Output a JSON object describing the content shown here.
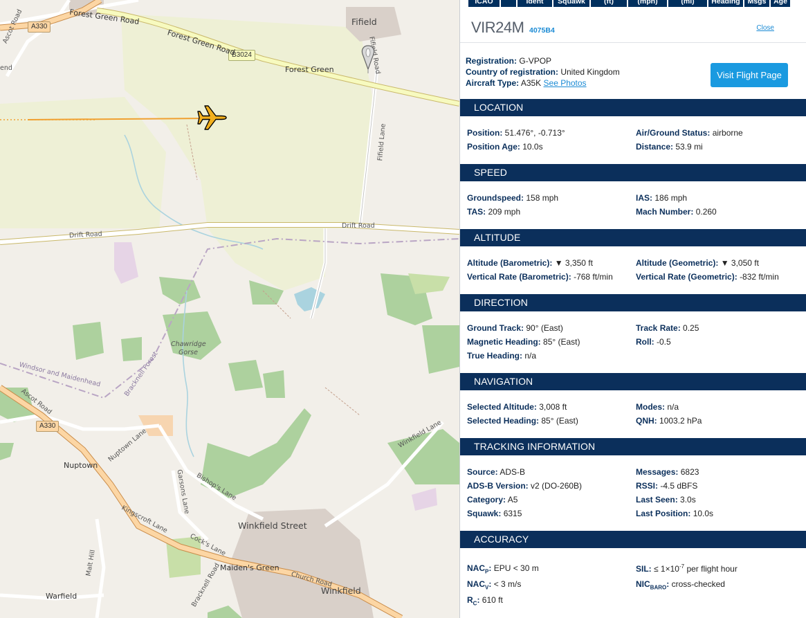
{
  "map": {
    "labels": {
      "fifield": "Fifield",
      "forest_green_road_1": "Forest Green Road",
      "forest_green_road_2": "Forest Green Road",
      "forest_green": "Forest Green",
      "fifield_road": "Fifield Road",
      "fifield_lane": "Fifield Lane",
      "drift_road_w": "Drift Road",
      "drift_road_e": "Drift Road",
      "chawridge_gorse": "Chawridge Gorse",
      "bracknell_forest": "Bracknell Forest",
      "windsor_maidenhead": "Windsor and Maidenhead",
      "ascot_road_n": "Ascot Road",
      "ascot_road_s": "Ascot Road",
      "end": "end",
      "nuptown": "Nuptown",
      "nuptown_lane": "Nuptown Lane",
      "garsons_lane": "Garsons Lane",
      "bishops_lane": "Bishop's Lane",
      "winkfield_street": "Winkfield Street",
      "winkfield_lane": "Winkfield Lane",
      "kingscroft_lane": "Kingscroft Lane",
      "cocks_lane": "Cock's Lane",
      "maidens_green": "Maiden's Green",
      "church_road": "Church Road",
      "winkfield": "Winkfield",
      "bracknell_road": "Bracknell Road",
      "malt_hill": "Malt Hill",
      "warfield": "Warfield",
      "a330_n": "A330",
      "a330_s": "A330",
      "b3024": "B3024"
    },
    "aircraft_icon": "airplane-icon",
    "pin_icon": "map-pin-icon",
    "track_color": "#f0a030"
  },
  "panel": {
    "column_headers": [
      "ICAO",
      "",
      "Ident",
      "Squawk",
      "(ft)",
      "(mph)",
      "(mi)",
      "Heading",
      "Msgs",
      "Age"
    ],
    "callsign": "VIR24M",
    "icao": "4075B4",
    "close_label": "Close",
    "registration_label": "Registration:",
    "registration": "G-VPOP",
    "country_label": "Country of registration:",
    "country": "United Kingdom",
    "aircraft_type_label": "Aircraft Type:",
    "aircraft_type": "A35K",
    "see_photos": "See Photos",
    "visit_button": "Visit Flight Page",
    "sections": {
      "location": {
        "title": "LOCATION",
        "position_label": "Position:",
        "position": "51.476°, -0.713°",
        "air_ground_label": "Air/Ground Status:",
        "air_ground": "airborne",
        "position_age_label": "Position Age:",
        "position_age": "10.0s",
        "distance_label": "Distance:",
        "distance": "53.9 mi"
      },
      "speed": {
        "title": "SPEED",
        "groundspeed_label": "Groundspeed:",
        "groundspeed": "158 mph",
        "ias_label": "IAS:",
        "ias": "186 mph",
        "tas_label": "TAS:",
        "tas": "209 mph",
        "mach_label": "Mach Number:",
        "mach": "0.260"
      },
      "altitude": {
        "title": "ALTITUDE",
        "baro_label": "Altitude (Barometric):",
        "baro": "▼ 3,350 ft",
        "geom_label": "Altitude (Geometric):",
        "geom": "▼ 3,050 ft",
        "vr_baro_label": "Vertical Rate (Barometric):",
        "vr_baro": "-768 ft/min",
        "vr_geom_label": "Vertical Rate (Geometric):",
        "vr_geom": "-832 ft/min"
      },
      "direction": {
        "title": "DIRECTION",
        "ground_track_label": "Ground Track:",
        "ground_track": "90° (East)",
        "track_rate_label": "Track Rate:",
        "track_rate": "0.25",
        "mag_heading_label": "Magnetic Heading:",
        "mag_heading": "85° (East)",
        "roll_label": "Roll:",
        "roll": "-0.5",
        "true_heading_label": "True Heading:",
        "true_heading": "n/a"
      },
      "navigation": {
        "title": "NAVIGATION",
        "sel_alt_label": "Selected Altitude:",
        "sel_alt": "3,008 ft",
        "modes_label": "Modes:",
        "modes": "n/a",
        "sel_heading_label": "Selected Heading:",
        "sel_heading": "85° (East)",
        "qnh_label": "QNH:",
        "qnh": "1003.2 hPa"
      },
      "tracking": {
        "title": "TRACKING INFORMATION",
        "source_label": "Source:",
        "source": "ADS-B",
        "messages_label": "Messages:",
        "messages": "6823",
        "adsb_version_label": "ADS-B Version:",
        "adsb_version": "v2 (DO-260B)",
        "rssi_label": "RSSI:",
        "rssi": "-4.5 dBFS",
        "category_label": "Category:",
        "category": "A5",
        "last_seen_label": "Last Seen:",
        "last_seen": "3.0s",
        "squawk_label": "Squawk:",
        "squawk": "6315",
        "last_position_label": "Last Position:",
        "last_position": "10.0s"
      },
      "accuracy": {
        "title": "ACCURACY",
        "nacp_label": "NAC",
        "nacp_sub": "P",
        "nacp": "EPU < 30 m",
        "sil_label": "SIL:",
        "sil_pre": "≤ 1×10",
        "sil_exp": "-7",
        "sil_post": "per flight hour",
        "nacv_label": "NAC",
        "nacv_sub": "V",
        "nacv": "< 3 m/s",
        "nic_label": "NIC",
        "nic_sub": "BARO",
        "nic": "cross-checked",
        "rc_label": "R",
        "rc_sub": "C",
        "rc": "610 ft"
      }
    }
  }
}
